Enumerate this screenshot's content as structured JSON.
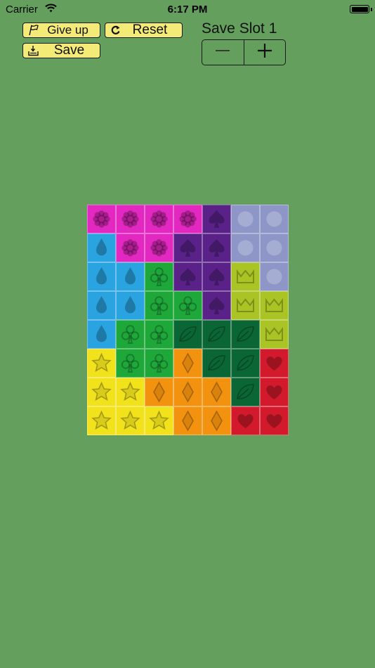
{
  "status_bar": {
    "carrier": "Carrier",
    "time": "6:17 PM"
  },
  "toolbar": {
    "give_up_label": "Give up",
    "reset_label": "Reset",
    "save_label": "Save"
  },
  "save_slot": {
    "title": "Save Slot 1",
    "decrement_icon": "minus-icon",
    "increment_icon": "plus-icon"
  },
  "colors": {
    "background": "#649f5e",
    "button_fill": "#f4ea78",
    "flower": "#e228c0",
    "spade": "#5a2289",
    "circle": "#8d96c6",
    "drop": "#2aa4e0",
    "club": "#1fa83a",
    "crown": "#a9c424",
    "leaf": "#0b6636",
    "star": "#f1e21c",
    "diamond": "#f3920e",
    "heart": "#d31a2c"
  },
  "board": {
    "columns": 7,
    "rows": 8,
    "grid": [
      [
        "flower",
        "flower",
        "flower",
        "flower",
        "spade",
        "circle",
        "circle"
      ],
      [
        "drop",
        "flower",
        "flower",
        "spade",
        "spade",
        "circle",
        "circle"
      ],
      [
        "drop",
        "drop",
        "club",
        "spade",
        "spade",
        "crown",
        "circle"
      ],
      [
        "drop",
        "drop",
        "club",
        "club",
        "spade",
        "crown",
        "crown"
      ],
      [
        "drop",
        "club",
        "club",
        "leaf",
        "leaf",
        "leaf",
        "crown"
      ],
      [
        "star",
        "club",
        "club",
        "diamond",
        "leaf",
        "leaf",
        "heart"
      ],
      [
        "star",
        "star",
        "diamond",
        "diamond",
        "diamond",
        "leaf",
        "heart"
      ],
      [
        "star",
        "star",
        "star",
        "diamond",
        "diamond",
        "heart",
        "heart"
      ]
    ]
  }
}
